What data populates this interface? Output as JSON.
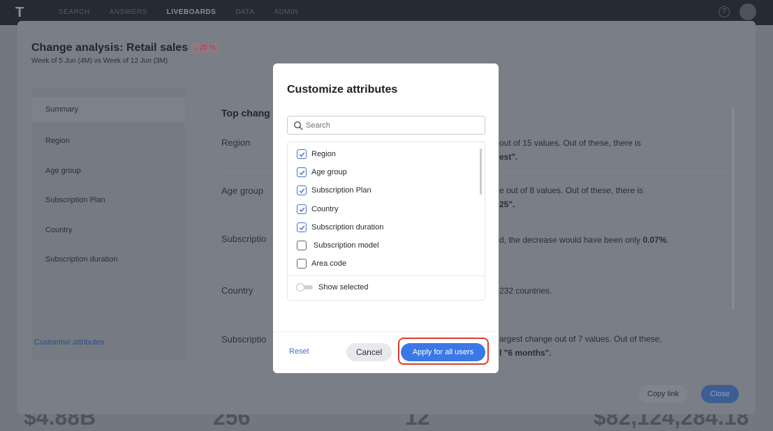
{
  "topbar": {
    "logo": "T",
    "nav_items": [
      "SEARCH",
      "ANSWERS",
      "LIVEBOARDS",
      "DATA",
      "ADMIN"
    ],
    "active_index": 2,
    "help": "?"
  },
  "background_numbers": [
    "$4.88B",
    "256",
    "12",
    "$82,124,284.18"
  ],
  "panel": {
    "title": "Change analysis: Retail sales",
    "delta": "↓ 25 %",
    "subtitle": "Week of 5 Jun (4M) vs Week of 12 Jun (3M)",
    "nav_items": [
      "Summary",
      "Region",
      "Age group",
      "Subscription Plan",
      "Country",
      "Subscription duration"
    ],
    "customise_link": "Customise attributes",
    "content_title": "Top chang",
    "rows": [
      {
        "label": "Region",
        "text_line1": "out of 15 values. Out of these, there is",
        "text_line2": "est\"."
      },
      {
        "label": "Age group",
        "text_line1": "e out of 8 values. Out of these, there is",
        "text_line2": "25\"."
      },
      {
        "label": "Subscriptio",
        "text_line1": "d, the decrease would have been only ",
        "text_bold": "0.07%",
        "text_line2": ""
      },
      {
        "label": "Country",
        "text_line1": "232 countries.",
        "text_line2": ""
      },
      {
        "label": "Subscriptio",
        "text_line1": "argest change out of 7 values. Out of these,",
        "text_line2": "l \"6 months\"."
      }
    ],
    "copy_link": "Copy link",
    "close": "Close"
  },
  "dialog": {
    "title": "Customize attributes",
    "search_placeholder": "Search",
    "options": [
      {
        "label": "Region",
        "checked": true
      },
      {
        "label": "Age group",
        "checked": true
      },
      {
        "label": "Subscription Plan",
        "checked": true
      },
      {
        "label": "Country",
        "checked": true
      },
      {
        "label": "Subscription duration",
        "checked": true
      },
      {
        "label": "Subscription model",
        "checked": false
      },
      {
        "label": "Area code",
        "checked": false
      }
    ],
    "show_selected_label": "Show selected",
    "show_selected_on": false,
    "reset": "Reset",
    "cancel": "Cancel",
    "apply": "Apply for all users",
    "colors": {
      "accent": "#3a78e8",
      "highlight": "#e23b28"
    }
  }
}
